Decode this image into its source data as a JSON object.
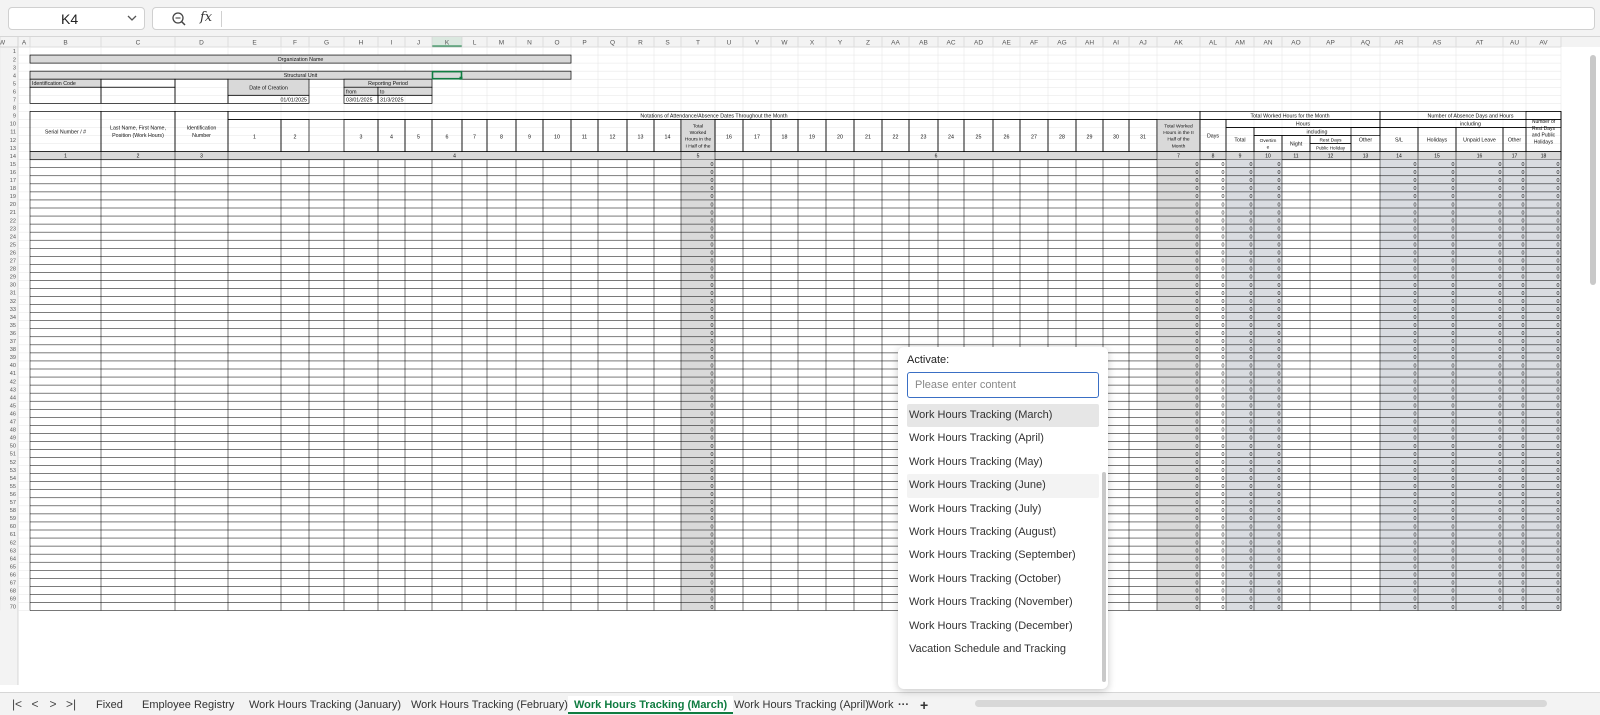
{
  "formula_bar": {
    "cell_ref": "K4",
    "fx_symbol": "fx"
  },
  "columns": [
    "A",
    "B",
    "C",
    "D",
    "E",
    "F",
    "G",
    "H",
    "I",
    "J",
    "K",
    "L",
    "M",
    "N",
    "O",
    "P",
    "Q",
    "R",
    "S",
    "T",
    "U",
    "V",
    "W",
    "X",
    "Y",
    "Z",
    "AA",
    "AB",
    "AC",
    "AD",
    "AE",
    "AF",
    "AG",
    "AH",
    "AI",
    "AJ",
    "AK",
    "AL",
    "AM",
    "AN",
    "AO",
    "AP",
    "AQ",
    "AR",
    "AS",
    "AT",
    "AU",
    "AV",
    "AW"
  ],
  "row_start": 1,
  "row_end": 70,
  "form": {
    "org_name": "Organization Name",
    "structural_unit": "Structural Unit",
    "identification_code": "Identification Code",
    "date_of_creation": "Date of Creation",
    "reporting_period": "Reporting Period",
    "from": "from",
    "to": "to",
    "date_created_value": "01/01/2025",
    "from_value": "03/01/2025",
    "to_value": "31/3/2025",
    "notations_header": "Notations of Attendance/Absence Dates Throughout the Month",
    "serial_number": "Serial Number / #",
    "last_name": "Last Name, First Name, Position (Work Hours)",
    "identification_number": "Identification Number",
    "total_worked_first_half": "Total Worked Hours in the I Half of the Month",
    "total_worked_second_half": "Total Worked Hours in the II Half of the Month",
    "total_month_hours": "Total Worked Hours for the Month",
    "hours": "Hours",
    "including": "including",
    "days": "Days",
    "total": "Total",
    "overtime": "Overtime",
    "night": "Night",
    "rest_days_holiday": "Rest Days Public Holiday",
    "other": "Other",
    "absence_header": "Number of Absence Days and Hours",
    "sl": "S/L",
    "holidays": "Holidays",
    "unpaid_leave": "Unpaid Leave",
    "rest_days_public_holidays": "Number of Rest Days and Public Holidays",
    "days_first_half": [
      "1",
      "2",
      "3",
      "4",
      "5",
      "6",
      "7",
      "8",
      "9",
      "10",
      "11",
      "12",
      "13",
      "14",
      "15"
    ],
    "days_second_half": [
      "16",
      "17",
      "18",
      "19",
      "20",
      "21",
      "22",
      "23",
      "24",
      "25",
      "26",
      "27",
      "28",
      "29",
      "30",
      "31"
    ],
    "section_numbers": [
      "1",
      "2",
      "3",
      "4",
      "5",
      "6",
      "7",
      "8",
      "9",
      "10",
      "11",
      "12",
      "13",
      "14",
      "15",
      "16",
      "17",
      "18"
    ],
    "zero": "0"
  },
  "popup": {
    "title": "Activate:",
    "placeholder": "Please enter content",
    "items": [
      "Work Hours Tracking (March)",
      "Work Hours Tracking (April)",
      "Work Hours Tracking (May)",
      "Work Hours Tracking (June)",
      "Work Hours Tracking (July)",
      "Work Hours Tracking (August)",
      "Work Hours Tracking (September)",
      "Work Hours Tracking (October)",
      "Work Hours Tracking (November)",
      "Work Hours Tracking (December)",
      "Vacation Schedule and Tracking"
    ]
  },
  "sheet_tabs": [
    "Fixed",
    "Employee Registry",
    "Work Hours Tracking (January)",
    "Work Hours Tracking (February)",
    "Work Hours Tracking (March)",
    "Work Hours Tracking (April)",
    "Work"
  ],
  "active_tab": "Work Hours Tracking (March)",
  "nav": {
    "first": "|<",
    "prev": "<",
    "next": ">",
    "last": ">|",
    "more": "···",
    "add": "+"
  },
  "colors": {
    "accent": "#107c41",
    "header_gray": "#d9d9d9",
    "shaded_col": "#d9dce1"
  }
}
